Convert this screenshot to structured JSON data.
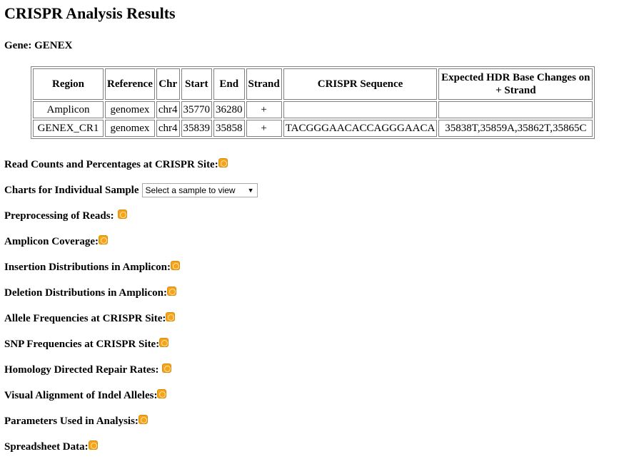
{
  "page": {
    "title": "CRISPR Analysis Results",
    "gene_label": "Gene: GENEX"
  },
  "table": {
    "headers": [
      "Region",
      "Reference",
      "Chr",
      "Start",
      "End",
      "Strand",
      "CRISPR Sequence",
      "Expected HDR Base Changes on + Strand"
    ],
    "rows": [
      [
        "Amplicon",
        "genomex",
        "chr4",
        "35770",
        "36280",
        "+",
        "",
        ""
      ],
      [
        "GENEX_CR1",
        "genomex",
        "chr4",
        "35839",
        "35858",
        "+",
        "TACGGGAACACCAGGGAACA",
        "35838T,35859A,35862T,35865C"
      ]
    ]
  },
  "sections": {
    "read_counts": "Read Counts and Percentages at CRISPR Site:",
    "charts_individual": "Charts for Individual Sample",
    "sample_select_value": "Select a sample to view",
    "preprocessing": "Preprocessing of Reads:",
    "amplicon_coverage": "Amplicon Coverage:",
    "insertion_distributions": "Insertion Distributions in Amplicon:",
    "deletion_distributions": "Deletion Distributions in Amplicon:",
    "allele_frequencies": "Allele Frequencies at CRISPR Site:",
    "snp_frequencies": "SNP Frequencies at CRISPR Site:",
    "hdr_rates": "Homology Directed Repair Rates:",
    "visual_alignment": "Visual Alignment of Indel Alleles:",
    "parameters": "Parameters Used in Analysis:",
    "spreadsheet": "Spreadsheet Data:"
  },
  "icons": {
    "expand": "expand-icon",
    "dropdown": "chevron-down-icon"
  },
  "colors": {
    "expand_icon": "#f5a319"
  }
}
